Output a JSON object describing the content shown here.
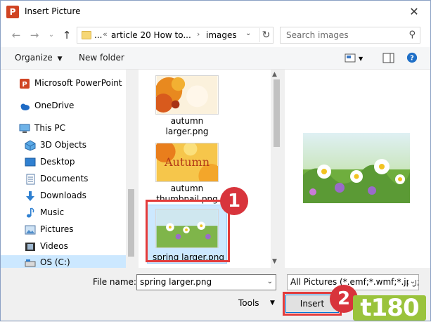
{
  "window": {
    "title": "Insert Picture",
    "app_badge": "P"
  },
  "address": {
    "segments": [
      "...",
      "article 20 How to...",
      "images"
    ],
    "separators": [
      "«",
      "›",
      "›"
    ]
  },
  "search": {
    "placeholder": "Search images"
  },
  "toolbar": {
    "organize": "Organize",
    "new_folder": "New folder"
  },
  "nav": {
    "items": [
      {
        "label": "Microsoft PowerPoint",
        "icon": "powerpoint-icon"
      },
      {
        "label": "OneDrive",
        "icon": "cloud-icon"
      },
      {
        "label": "This PC",
        "icon": "computer-icon"
      },
      {
        "label": "3D Objects",
        "icon": "cube-icon"
      },
      {
        "label": "Desktop",
        "icon": "desktop-icon"
      },
      {
        "label": "Documents",
        "icon": "document-icon"
      },
      {
        "label": "Downloads",
        "icon": "download-icon"
      },
      {
        "label": "Music",
        "icon": "music-icon"
      },
      {
        "label": "Pictures",
        "icon": "pictures-icon"
      },
      {
        "label": "Videos",
        "icon": "video-icon"
      },
      {
        "label": "OS (C:)",
        "icon": "drive-icon"
      }
    ]
  },
  "files": [
    {
      "line1": "autumn",
      "line2": "larger.png"
    },
    {
      "line1": "autumn",
      "line2": "thumbnail.png",
      "overlay_text": "Autumn"
    },
    {
      "line1": "spring larger.png",
      "selected": true
    }
  ],
  "badges": {
    "step1": "1",
    "step2": "2"
  },
  "bottom": {
    "file_name_label": "File name:",
    "file_name_value": "spring larger.png",
    "file_type_value": "All Pictures (*.emf;*.wmf;*.jpg;*",
    "tools_label": "Tools",
    "insert_label": "Insert"
  },
  "watermark": "t180",
  "colors": {
    "highlight": "#e33b3b",
    "badge": "#d8343c",
    "selection": "#cce8ff",
    "logo": "#9ac33c"
  }
}
